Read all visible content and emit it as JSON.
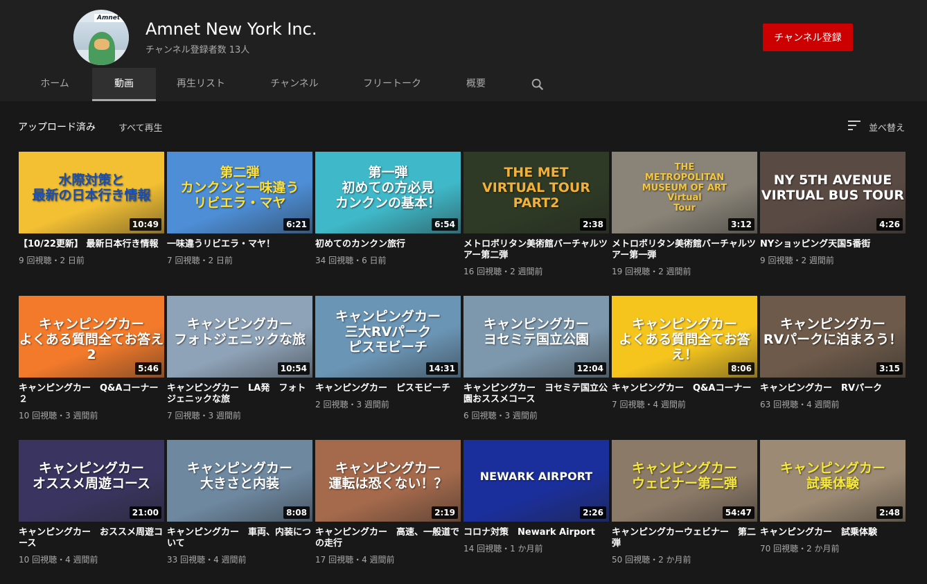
{
  "channel": {
    "name": "Amnet New York Inc.",
    "subscribers": "チャンネル登録者数 13人",
    "avatar_logo": "Amnet",
    "subscribe_label": "チャンネル登録"
  },
  "tabs": [
    {
      "label": "ホーム"
    },
    {
      "label": "動画"
    },
    {
      "label": "再生リスト"
    },
    {
      "label": "チャンネル"
    },
    {
      "label": "フリートーク"
    },
    {
      "label": "概要"
    }
  ],
  "search_icon": "search-icon",
  "toolbar": {
    "section_label": "アップロード済み",
    "play_all": "すべて再生",
    "sort_label": "並べ替え"
  },
  "videos": [
    {
      "title": "【10/22更新】 最新日本行き情報",
      "meta": "9 回視聴・2 日前",
      "duration": "10:49",
      "thumb_text": "水際対策と\n最新の日本行き情報",
      "thumb_bg": "#f4c033",
      "thumb_color": "#1a4fb0"
    },
    {
      "title": "一味違うリビエラ・マヤ！",
      "meta": "7 回視聴・2 日前",
      "duration": "6:21",
      "thumb_text": "第二弾\nカンクンと一味違う\nリビエラ・マヤ",
      "thumb_bg": "#4d8ed6",
      "thumb_color": "#ffe033"
    },
    {
      "title": "初めてのカンクン旅行",
      "meta": "34 回視聴・6 日前",
      "duration": "6:54",
      "thumb_text": "第一弾\n初めての方必見\nカンクンの基本！",
      "thumb_bg": "#3fb9c9",
      "thumb_color": "#ffffff"
    },
    {
      "title": "メトロポリタン美術館バーチャルツアー第二弾",
      "meta": "16 回視聴・2 週間前",
      "duration": "2:38",
      "thumb_text": "THE MET\nVIRTUAL TOUR\nPART2",
      "thumb_bg": "#2e3a25",
      "thumb_color": "#f0b13a"
    },
    {
      "title": "メトロポリタン美術館バーチャルツアー第一弾",
      "meta": "19 回視聴・2 週間前",
      "duration": "3:12",
      "thumb_text": "THE\nMETROPOLITAN\nMUSEUM OF ART\nVirtual\nTour",
      "thumb_bg": "#8a8478",
      "thumb_color": "#f2c640"
    },
    {
      "title": "NYショッピング天国5番街",
      "meta": "9 回視聴・2 週間前",
      "duration": "4:26",
      "thumb_text": "NY 5TH AVENUE\nVIRTUAL BUS TOUR",
      "thumb_bg": "#5a4a44",
      "thumb_color": "#ffffff"
    },
    {
      "title": "キャンピングカー　Q&Aコーナー２",
      "meta": "10 回視聴・3 週間前",
      "duration": "5:46",
      "thumb_text": "キャンピングカー\nよくある質問全てお答え2",
      "thumb_bg": "#f37a2a",
      "thumb_color": "#ffffff"
    },
    {
      "title": "キャンピングカー　LA発　フォトジェニックな旅",
      "meta": "7 回視聴・3 週間前",
      "duration": "10:54",
      "thumb_text": "キャンピングカー\nフォトジェニックな旅",
      "thumb_bg": "#8fa3b8",
      "thumb_color": "#ffffff"
    },
    {
      "title": "キャンピングカー　ピスモビーチ",
      "meta": "2 回視聴・3 週間前",
      "duration": "14:31",
      "thumb_text": "キャンピングカー\n三大RVパーク\nピスモビーチ",
      "thumb_bg": "#6b95b5",
      "thumb_color": "#ffffff"
    },
    {
      "title": "キャンピングカー　ヨセミテ国立公園おススメコース",
      "meta": "6 回視聴・3 週間前",
      "duration": "12:04",
      "thumb_text": "キャンピングカー\nヨセミテ国立公園",
      "thumb_bg": "#7d98ad",
      "thumb_color": "#ffffff"
    },
    {
      "title": "キャンピングカー　Q&Aコーナー",
      "meta": "7 回視聴・4 週間前",
      "duration": "8:06",
      "thumb_text": "キャンピングカー\nよくある質問全てお答え！",
      "thumb_bg": "#f5c51e",
      "thumb_color": "#ffffff"
    },
    {
      "title": "キャンピングカー　RVパーク",
      "meta": "63 回視聴・4 週間前",
      "duration": "3:15",
      "thumb_text": "キャンピングカー\nRVパークに泊まろう！",
      "thumb_bg": "#6d5a4a",
      "thumb_color": "#ffffff"
    },
    {
      "title": "キャンピングカー　おススメ周遊コース",
      "meta": "10 回視聴・4 週間前",
      "duration": "21:00",
      "thumb_text": "キャンピングカー\nオススメ周遊コース",
      "thumb_bg": "#3a3560",
      "thumb_color": "#ffffff"
    },
    {
      "title": "キャンピングカー　車両、内装について",
      "meta": "33 回視聴・4 週間前",
      "duration": "8:08",
      "thumb_text": "キャンピングカー\n大きさと内装",
      "thumb_bg": "#6e88a0",
      "thumb_color": "#ffffff"
    },
    {
      "title": "キャンピングカー　高速、一般道での走行",
      "meta": "17 回視聴・4 週間前",
      "duration": "2:19",
      "thumb_text": "キャンピングカー\n運転は恐くない！？",
      "thumb_bg": "#a56a4c",
      "thumb_color": "#ffffff"
    },
    {
      "title": "コロナ対策　Newark Airport",
      "meta": "14 回視聴・1 か月前",
      "duration": "2:26",
      "thumb_text": "NEWARK AIRPORT",
      "thumb_bg": "#1b2f9c",
      "thumb_color": "#ffffff"
    },
    {
      "title": "キャンピングカーウェビナー　第二弾",
      "meta": "50 回視聴・2 か月前",
      "duration": "54:47",
      "thumb_text": "キャンピングカー\nウェビナー第二弾",
      "thumb_bg": "#8c7a68",
      "thumb_color": "#f6e83a"
    },
    {
      "title": "キャンピングカー　試乗体験",
      "meta": "70 回視聴・2 か月前",
      "duration": "2:48",
      "thumb_text": "キャンピングカー\n試乗体験",
      "thumb_bg": "#9c8a74",
      "thumb_color": "#f6e83a"
    }
  ]
}
